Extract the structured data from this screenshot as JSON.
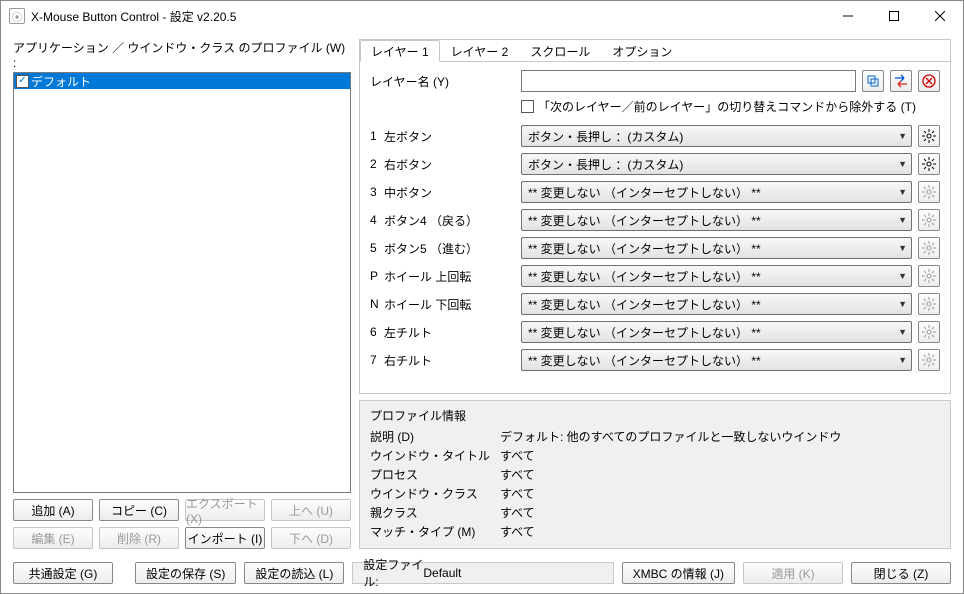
{
  "window": {
    "title": "X-Mouse Button Control - 設定     v2.20.5"
  },
  "left": {
    "label": "アプリケーション ／ ウインドウ・クラス のプロファイル (W) :",
    "items": [
      {
        "name": "デフォルト",
        "checked": true,
        "selected": true
      }
    ],
    "btns": {
      "add": "追加 (A)",
      "copy": "コピー (C)",
      "export": "エクスポート(X)",
      "up": "上へ (U)",
      "edit": "編集 (E)",
      "delete": "削除 (R)",
      "import": "インポート (I)",
      "down": "下へ (D)"
    }
  },
  "tabs": {
    "layer1": "レイヤー 1",
    "layer2": "レイヤー 2",
    "scroll": "スクロール",
    "option": "オプション"
  },
  "layer": {
    "name_label": "レイヤー名 (Y)",
    "name_value": "",
    "exclude_label": "「次のレイヤー／前のレイヤー」の切り替えコマンドから除外する (T)",
    "rows": [
      {
        "p": "1",
        "n": "左ボタン",
        "v": "ボタン・長押し ：(カスタム)",
        "gear_enabled": true
      },
      {
        "p": "2",
        "n": "右ボタン",
        "v": "ボタン・長押し ：(カスタム)",
        "gear_enabled": true
      },
      {
        "p": "3",
        "n": "中ボタン",
        "v": "** 変更しない （インターセプトしない） **",
        "gear_enabled": false
      },
      {
        "p": "4",
        "n": "ボタン4 （戻る）",
        "v": "** 変更しない （インターセプトしない） **",
        "gear_enabled": false
      },
      {
        "p": "5",
        "n": "ボタン5 （進む）",
        "v": "** 変更しない （インターセプトしない） **",
        "gear_enabled": false
      },
      {
        "p": "P",
        "n": "ホイール 上回転",
        "v": "** 変更しない （インターセプトしない） **",
        "gear_enabled": false
      },
      {
        "p": "N",
        "n": "ホイール 下回転",
        "v": "** 変更しない （インターセプトしない） **",
        "gear_enabled": false
      },
      {
        "p": "6",
        "n": "左チルト",
        "v": "** 変更しない （インターセプトしない） **",
        "gear_enabled": false
      },
      {
        "p": "7",
        "n": "右チルト",
        "v": "** 変更しない （インターセプトしない） **",
        "gear_enabled": false
      }
    ]
  },
  "info": {
    "title": "プロファイル情報",
    "rows": [
      {
        "k": "説明 (D)",
        "v": "デフォルト: 他のすべてのプロファイルと一致しないウインドウ"
      },
      {
        "k": "ウインドウ・タイトル",
        "v": "すべて"
      },
      {
        "k": "プロセス",
        "v": "すべて"
      },
      {
        "k": "ウインドウ・クラス",
        "v": "すべて"
      },
      {
        "k": "親クラス",
        "v": "すべて"
      },
      {
        "k": "マッチ・タイプ (M)",
        "v": "すべて"
      }
    ]
  },
  "bottom": {
    "common": "共通設定 (G)",
    "save": "設定の保存 (S)",
    "load": "設定の読込 (L)",
    "file_label": "設定ファイル:",
    "file_value": "Default",
    "about": "XMBC の情報 (J)",
    "apply": "適用 (K)",
    "close": "閉じる (Z)"
  }
}
